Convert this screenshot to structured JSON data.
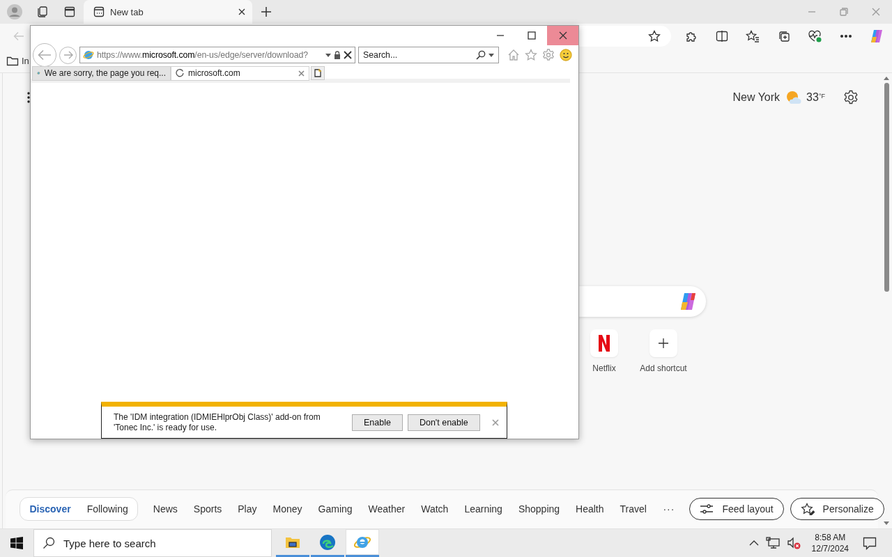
{
  "edge": {
    "tabs": [
      {
        "title": "New tab",
        "selected": true
      }
    ],
    "back_disabled": true,
    "favorites_bar": {
      "items": [
        {
          "label": "In"
        }
      ]
    },
    "weather": {
      "city": "New York",
      "temperature": "33",
      "unit": "°F"
    },
    "shortcuts": [
      {
        "label": "Netflix",
        "kind": "site"
      },
      {
        "label": "Add shortcut",
        "kind": "add"
      }
    ],
    "feed_tabs": [
      {
        "label": "Discover",
        "kind": "toggle",
        "selected": true
      },
      {
        "label": "Following",
        "kind": "toggle",
        "selected": false
      },
      {
        "label": "News",
        "kind": "topic",
        "selected": false
      },
      {
        "label": "Sports",
        "kind": "topic",
        "selected": false
      },
      {
        "label": "Play",
        "kind": "topic",
        "selected": false
      },
      {
        "label": "Money",
        "kind": "topic",
        "selected": false
      },
      {
        "label": "Gaming",
        "kind": "topic",
        "selected": false
      },
      {
        "label": "Weather",
        "kind": "topic",
        "selected": false
      },
      {
        "label": "Watch",
        "kind": "topic",
        "selected": false
      },
      {
        "label": "Learning",
        "kind": "topic",
        "selected": false
      },
      {
        "label": "Shopping",
        "kind": "topic",
        "selected": false
      },
      {
        "label": "Health",
        "kind": "topic",
        "selected": false
      },
      {
        "label": "Travel",
        "kind": "topic",
        "selected": false
      }
    ],
    "feed_more": "···",
    "feed_buttons": [
      {
        "label": "Feed layout",
        "kind": "layout"
      },
      {
        "label": "Personalize",
        "kind": "personalize"
      }
    ]
  },
  "ie_window": {
    "close_hovered": true,
    "address": "https://www.**microsoft.com**/en-us/edge/server/download?",
    "search_placeholder": "Search...",
    "tabs": [
      {
        "title": "We are sorry, the page you req...",
        "kind": "page",
        "selected": false
      },
      {
        "title": "microsoft.com",
        "kind": "loading",
        "selected": true
      }
    ],
    "notification": {
      "message": "The 'IDM integration (IDMIEHlprObj Class)' add-on from 'Tonec Inc.' is ready for use.",
      "buttons": [
        "Enable",
        "Don't enable"
      ]
    }
  },
  "taskbar": {
    "search_placeholder": "Type here to search",
    "apps": [
      {
        "kind": "explorer",
        "selected": false
      },
      {
        "kind": "edge",
        "selected": false
      },
      {
        "kind": "ie",
        "selected": true
      }
    ],
    "time": "8:58 AM",
    "date": "12/7/2024"
  }
}
